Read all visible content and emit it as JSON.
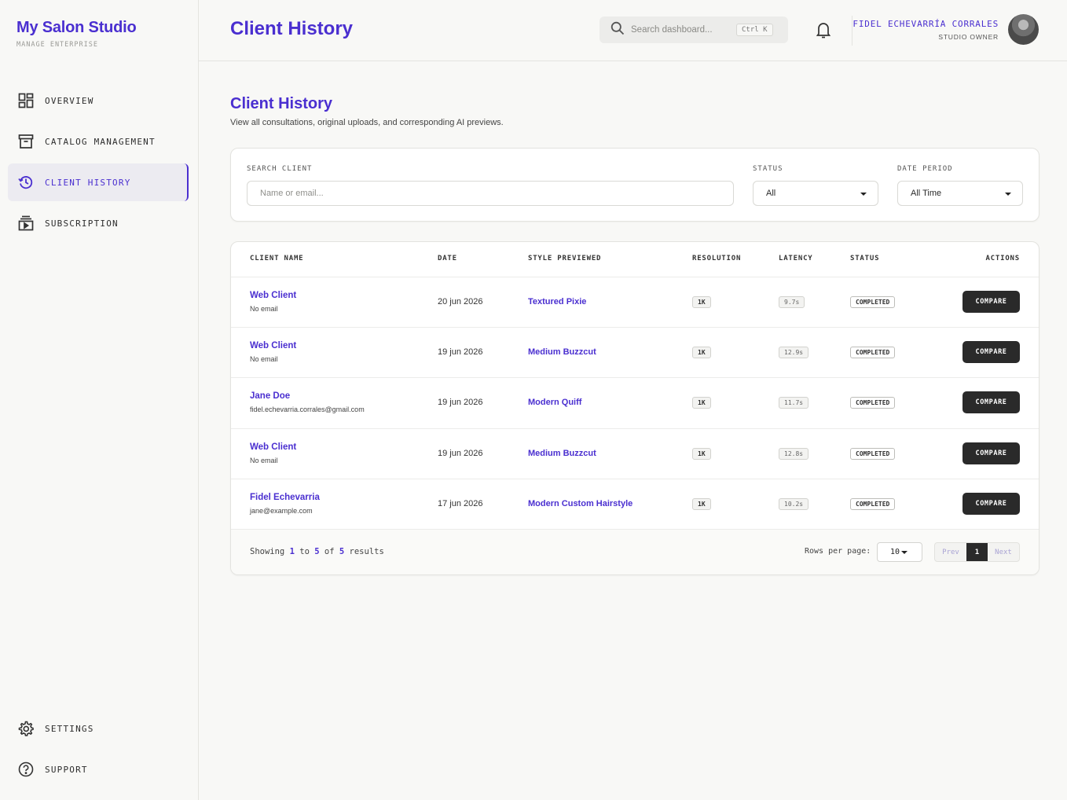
{
  "brand": {
    "title": "My Salon Studio",
    "subtitle": "MANAGE ENTERPRISE"
  },
  "nav": {
    "items": [
      {
        "label": "OVERVIEW",
        "icon": "dashboard-icon"
      },
      {
        "label": "CATALOG MANAGEMENT",
        "icon": "archive-icon"
      },
      {
        "label": "CLIENT HISTORY",
        "icon": "history-icon",
        "active": true
      },
      {
        "label": "SUBSCRIPTION",
        "icon": "subscriptions-icon"
      }
    ],
    "bottom": [
      {
        "label": "SETTINGS",
        "icon": "gear-icon"
      },
      {
        "label": "SUPPORT",
        "icon": "help-icon"
      }
    ]
  },
  "header": {
    "title": "Client History",
    "search_placeholder": "Search dashboard...",
    "shortcut": "Ctrl K",
    "user_name": "FIDEL ECHEVARRÍA CORRALES",
    "user_role": "STUDIO OWNER"
  },
  "page": {
    "title": "Client History",
    "subtitle": "View all consultations, original uploads, and corresponding AI previews."
  },
  "filters": {
    "search_label": "SEARCH CLIENT",
    "search_placeholder": "Name or email...",
    "status_label": "STATUS",
    "status_value": "All",
    "period_label": "DATE PERIOD",
    "period_value": "All Time"
  },
  "table": {
    "headers": {
      "client": "CLIENT NAME",
      "date": "DATE",
      "style": "STYLE PREVIEWED",
      "resolution": "RESOLUTION",
      "latency": "LATENCY",
      "status": "STATUS",
      "actions": "ACTIONS"
    },
    "rows": [
      {
        "name": "Web Client",
        "email": "No email",
        "date": "20 jun 2026",
        "style": "Textured Pixie",
        "resolution": "1K",
        "latency": "9.7s",
        "status": "COMPLETED",
        "action": "COMPARE"
      },
      {
        "name": "Web Client",
        "email": "No email",
        "date": "19 jun 2026",
        "style": "Medium Buzzcut",
        "resolution": "1K",
        "latency": "12.9s",
        "status": "COMPLETED",
        "action": "COMPARE"
      },
      {
        "name": "Jane Doe",
        "email": "fidel.echevarria.corrales@gmail.com",
        "date": "19 jun 2026",
        "style": "Modern Quiff",
        "resolution": "1K",
        "latency": "11.7s",
        "status": "COMPLETED",
        "action": "COMPARE"
      },
      {
        "name": "Web Client",
        "email": "No email",
        "date": "19 jun 2026",
        "style": "Medium Buzzcut",
        "resolution": "1K",
        "latency": "12.8s",
        "status": "COMPLETED",
        "action": "COMPARE"
      },
      {
        "name": "Fidel Echevarria",
        "email": "jane@example.com",
        "date": "17 jun 2026",
        "style": "Modern Custom Hairstyle",
        "resolution": "1K",
        "latency": "10.2s",
        "status": "COMPLETED",
        "action": "COMPARE"
      }
    ],
    "footer": {
      "showing_prefix": "Showing",
      "from": "1",
      "to_word": "to",
      "to": "5",
      "of_word": "of",
      "total": "5",
      "suffix": "results",
      "rows_per_page_label": "Rows per page:",
      "rows_per_page": "10",
      "prev": "Prev",
      "current_page": "1",
      "next": "Next"
    }
  },
  "colors": {
    "accent": "#4a2fd0",
    "dark": "#2a2a2a",
    "background": "#f8f8f6"
  }
}
